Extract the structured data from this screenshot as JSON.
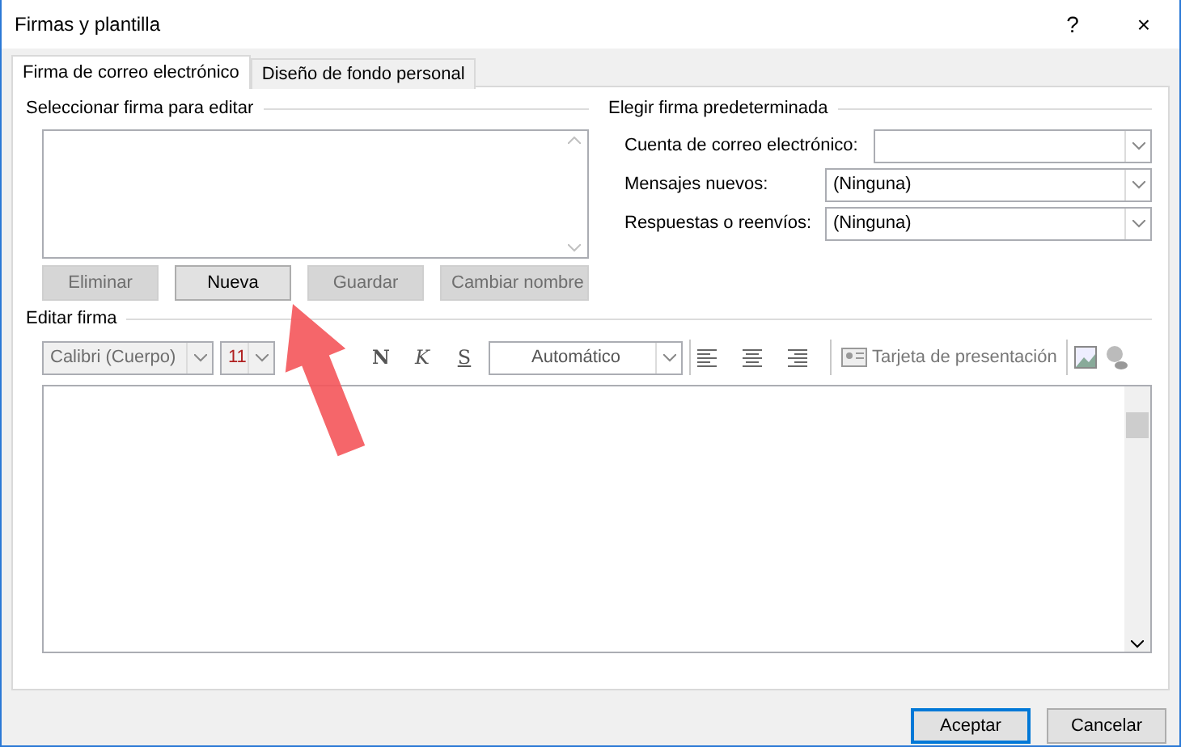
{
  "window": {
    "title": "Firmas y plantilla",
    "help": "?",
    "close": "×"
  },
  "tabs": [
    {
      "label": "Firma de correo electrónico",
      "selected": true
    },
    {
      "label": "Diseño de fondo personal",
      "selected": false
    }
  ],
  "select_signature": {
    "title": "Seleccionar firma para editar",
    "buttons": [
      {
        "label": "Eliminar",
        "disabled": true
      },
      {
        "label": "Nueva",
        "disabled": false
      },
      {
        "label": "Guardar",
        "disabled": true
      },
      {
        "label": "Cambiar nombre",
        "disabled": true
      }
    ]
  },
  "default_signature": {
    "title": "Elegir firma predeterminada",
    "fields": [
      {
        "label": "Cuenta de correo electrónico:"
      },
      {
        "label": "Mensajes nuevos:",
        "value": "(Ninguna)"
      },
      {
        "label": "Respuestas o reenvíos:",
        "value": "(Ninguna)"
      }
    ]
  },
  "edit_signature": {
    "title": "Editar firma",
    "font": "Calibri (Cuerpo)",
    "size": "11",
    "bold": "N",
    "italic": "K",
    "underline": "S",
    "color_name": "Automático",
    "business_card": "Tarjeta de presentación"
  },
  "footer": {
    "buttons": [
      {
        "label": "Aceptar",
        "default": true
      },
      {
        "label": "Cancelar",
        "default": false
      }
    ]
  }
}
